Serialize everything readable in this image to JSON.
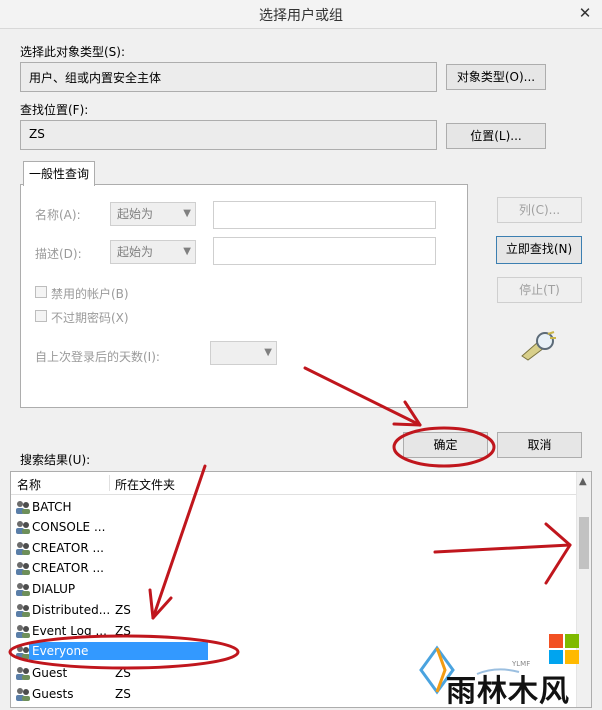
{
  "window": {
    "title": "选择用户或组",
    "close_glyph": "✕"
  },
  "object_type": {
    "label": "选择此对象类型(S):",
    "value": "用户、组或内置安全主体",
    "button": "对象类型(O)..."
  },
  "location": {
    "label": "查找位置(F):",
    "value": "ZS",
    "button": "位置(L)..."
  },
  "query_tab": {
    "label": "一般性查询"
  },
  "query": {
    "name_label": "名称(A):",
    "name_mode": "起始为",
    "desc_label": "描述(D):",
    "desc_mode": "起始为",
    "disabled_accounts": "禁用的帐户(B)",
    "no_expire_pwd": "不过期密码(X)",
    "days_label": "自上次登录后的天数(I):"
  },
  "side_buttons": {
    "columns": "列(C)...",
    "find_now": "立即查找(N)",
    "stop": "停止(T)"
  },
  "dialog_buttons": {
    "ok": "确定",
    "cancel": "取消"
  },
  "results": {
    "label": "搜索结果(U):",
    "columns": [
      "名称",
      "所在文件夹"
    ],
    "rows": [
      {
        "name": "BATCH",
        "folder": ""
      },
      {
        "name": "CONSOLE ...",
        "folder": ""
      },
      {
        "name": "CREATOR ...",
        "folder": ""
      },
      {
        "name": "CREATOR ...",
        "folder": ""
      },
      {
        "name": "DIALUP",
        "folder": ""
      },
      {
        "name": "Distributed...",
        "folder": "ZS"
      },
      {
        "name": "Event Log ...",
        "folder": "ZS"
      },
      {
        "name": "Everyone",
        "folder": "",
        "selected": true
      },
      {
        "name": "Guest",
        "folder": "ZS"
      },
      {
        "name": "Guests",
        "folder": "ZS"
      }
    ]
  },
  "watermark": {
    "text": "雨林木风",
    "sub": "YLMF"
  },
  "colors": {
    "selection": "#3399ff",
    "annotation": "#c0161d"
  },
  "icons": {
    "search": "search-flashlight-icon",
    "user": "user-group-icon",
    "close": "close-icon"
  }
}
